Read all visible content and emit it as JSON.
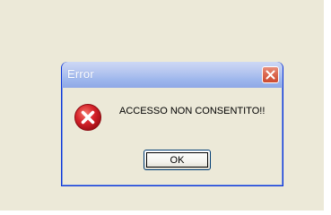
{
  "dialog": {
    "title": "Error",
    "message": "ACCESSO NON CONSENTITO!!",
    "ok_label": "OK",
    "icon": "error-icon",
    "close_icon": "close-icon"
  },
  "colors": {
    "desktop": "#ece9d8",
    "dialog_border": "#0831d9",
    "titlebar": "#9db6ec",
    "close_button": "#dc6a52",
    "error_icon": "#d6232b"
  }
}
